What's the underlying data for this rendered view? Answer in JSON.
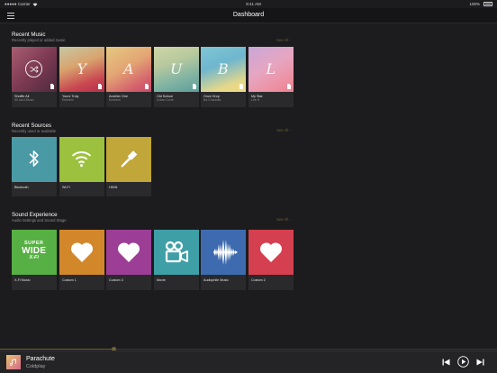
{
  "statusbar": {
    "carrier": "●●●●● Carrier",
    "time": "9:41 AM",
    "battery": "100%"
  },
  "header": {
    "title": "Dashboard"
  },
  "sections": {
    "music": {
      "title": "Recent Music",
      "subtitle": "Recently played or added music",
      "see_all": "See All ›",
      "items": [
        {
          "title": "Shuffle All",
          "subtitle": "50 card Music"
        },
        {
          "title": "Yours Truly",
          "subtitle": "Eminem",
          "letter": "Y"
        },
        {
          "title": "Another One",
          "subtitle": "Eminem",
          "letter": "A"
        },
        {
          "title": "Old School",
          "subtitle": "Urban Cone",
          "letter": "U"
        },
        {
          "title": "Once Drop",
          "subtitle": "Ba Charlotte",
          "letter": "B"
        },
        {
          "title": "My Star",
          "subtitle": "Lee H",
          "letter": "L"
        }
      ]
    },
    "sources": {
      "title": "Recent Sources",
      "subtitle": "Recently used or available",
      "see_all": "See All ›",
      "items": [
        {
          "title": "Bluetooth",
          "icon": "bluetooth-icon",
          "color": "#4a9aa6"
        },
        {
          "title": "Wi-Fi",
          "icon": "wifi-icon",
          "color": "#9cc13f"
        },
        {
          "title": "HDMI",
          "icon": "hdmi-icon",
          "color": "#c1a639"
        }
      ]
    },
    "sound": {
      "title": "Sound Experience",
      "subtitle": "Audio Settings and Sound Stage",
      "see_all": "See All ›",
      "items": [
        {
          "title": "X-Fi Music",
          "icon": "super-wide-xfi-logo",
          "color": "#57b043",
          "logo_top": "SUPER",
          "logo_mid": "WIDE",
          "logo_bot": "X-Fi"
        },
        {
          "title": "Custom 1",
          "icon": "heart-icon",
          "color": "#d3872b"
        },
        {
          "title": "Custom 3",
          "icon": "heart-icon",
          "color": "#9c3e96"
        },
        {
          "title": "Movie",
          "icon": "movie-camera-icon",
          "color": "#3f9fa6"
        },
        {
          "title": "Audiophile Music",
          "icon": "waveform-icon",
          "color": "#3e6baf"
        },
        {
          "title": "Custom 2",
          "icon": "heart-icon",
          "color": "#d4404f"
        }
      ]
    }
  },
  "player": {
    "title": "Parachute",
    "artist": "Coldplay",
    "progress": 0.23
  },
  "colors": {
    "accent": "#6b5f33",
    "background": "#1c1c1e"
  }
}
